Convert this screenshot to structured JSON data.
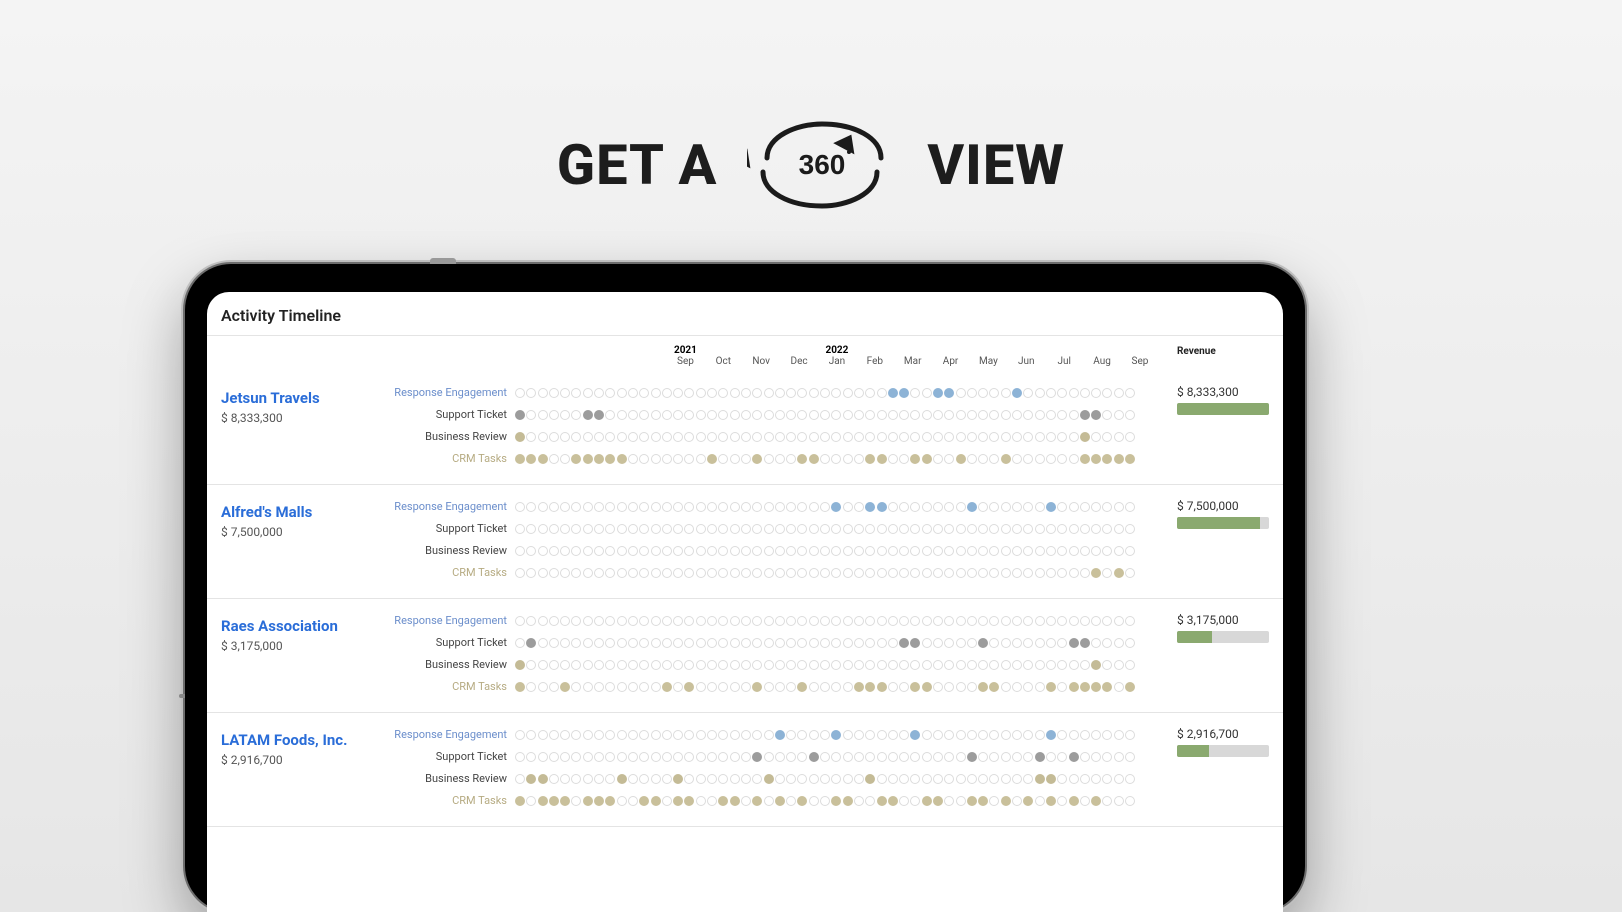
{
  "hero": {
    "word1": "GET A",
    "word2": "VIEW",
    "icon_text": "360"
  },
  "app": {
    "title": "Activity Timeline",
    "years": {
      "4": "2021",
      "8": "2022"
    },
    "months": [
      "",
      "",
      "",
      "",
      "Sep",
      "Oct",
      "Nov",
      "Dec",
      "Jan",
      "Feb",
      "Mar",
      "Apr",
      "May",
      "Jun",
      "Jul",
      "Aug",
      "Sep"
    ],
    "revenue_label": "Revenue",
    "track_labels": {
      "resp": "Response Engagement",
      "sup": "Support Ticket",
      "biz": "Business Review",
      "crm": "CRM Tasks"
    },
    "max_revenue": 8333300,
    "dot_cols": 55,
    "accounts": [
      {
        "name": "Jetsun Travels",
        "amount": "$ 8,333,300",
        "revenue": 8333300,
        "tracks": {
          "resp": [
            34,
            35,
            38,
            39,
            45
          ],
          "sup": [
            1,
            7,
            8,
            51,
            52
          ],
          "biz": [
            1,
            51
          ],
          "crm": [
            1,
            2,
            3,
            6,
            7,
            8,
            9,
            10,
            18,
            22,
            26,
            27,
            32,
            33,
            36,
            37,
            40,
            44,
            51,
            52,
            53,
            54,
            55
          ]
        }
      },
      {
        "name": "Alfred's Malls",
        "amount": "$ 7,500,000",
        "revenue": 7500000,
        "tracks": {
          "resp": [
            29,
            32,
            33,
            41,
            48
          ],
          "sup": [],
          "biz": [],
          "crm": [
            52,
            54
          ]
        }
      },
      {
        "name": "Raes Association",
        "amount": "$ 3,175,000",
        "revenue": 3175000,
        "tracks": {
          "resp": [],
          "sup": [
            2,
            35,
            36,
            42,
            50,
            51
          ],
          "biz": [
            1,
            52
          ],
          "crm": [
            1,
            5,
            14,
            16,
            22,
            26,
            31,
            32,
            33,
            36,
            37,
            42,
            43,
            48,
            50,
            51,
            52,
            53,
            55
          ]
        }
      },
      {
        "name": "LATAM Foods, Inc.",
        "amount": "$ 2,916,700",
        "revenue": 2916700,
        "tracks": {
          "resp": [
            24,
            29,
            36,
            48
          ],
          "sup": [
            22,
            27,
            41,
            47,
            50
          ],
          "biz": [
            2,
            3,
            10,
            15,
            23,
            32,
            47,
            48
          ],
          "crm": [
            1,
            3,
            4,
            5,
            7,
            8,
            9,
            12,
            13,
            15,
            16,
            19,
            20,
            22,
            24,
            26,
            29,
            30,
            33,
            34,
            37,
            38,
            41,
            42,
            44,
            46,
            48,
            50,
            52
          ]
        }
      }
    ]
  }
}
